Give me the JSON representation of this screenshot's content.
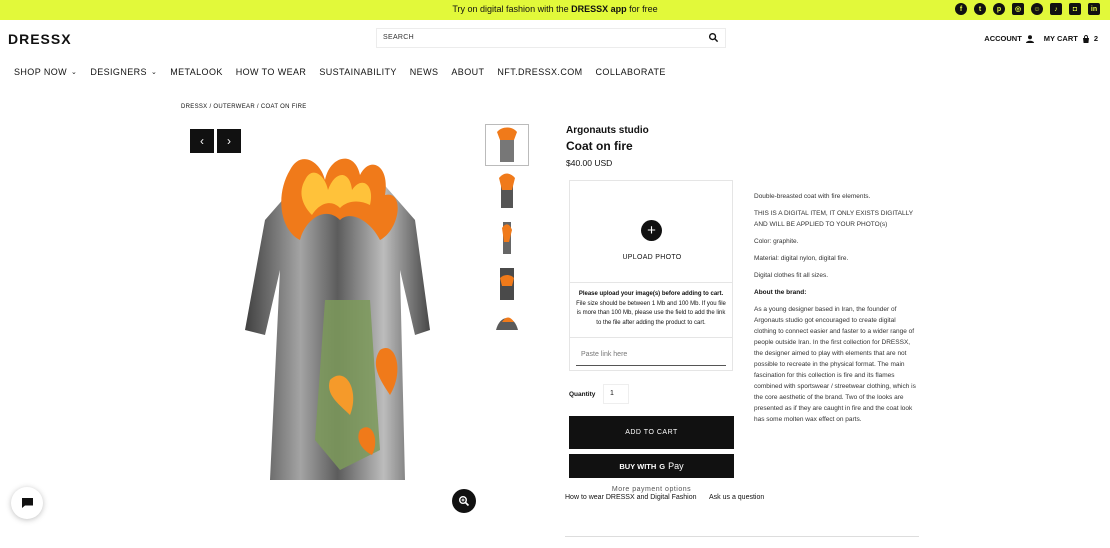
{
  "topbar": {
    "promo_before": "Try on digital fashion with the ",
    "promo_bold": "DRESSX app",
    "promo_after": " for free",
    "bg_color": "#e2f93a",
    "socials": [
      "facebook-icon",
      "twitter-icon",
      "pinterest-icon",
      "instagram-icon",
      "snapchat-icon",
      "tiktok-icon",
      "discord-icon",
      "linkedin-icon"
    ]
  },
  "header": {
    "logo": "DRESSX",
    "search_placeholder": "SEARCH",
    "account_label": "ACCOUNT",
    "cart_label": "MY CART",
    "cart_count": "2"
  },
  "nav": {
    "shop_now": "SHOP NOW",
    "designers": "DESIGNERS",
    "metalook": "METALOOK",
    "how_to_wear": "HOW TO WEAR",
    "sustainability": "SUSTAINABILITY",
    "news": "NEWS",
    "about": "ABOUT",
    "nft": "NFT.DRESSX.COM",
    "collaborate": "COLLABORATE"
  },
  "breadcrumb": {
    "text": "DRESSX / OUTERWEAR / COAT ON FIRE"
  },
  "product": {
    "brand": "Argonauts studio",
    "title": "Coat on fire",
    "price": "$40.00 USD",
    "upload_label": "UPLOAD PHOTO",
    "upload_note_bold": "Please upload your image(s) before adding to cart.",
    "upload_note": "File size should be between 1 Mb and 100 Mb. If you file is more than 100 Mb, please use the field to add the link to the file after adding the product to cart.",
    "link_placeholder": "Paste link here",
    "quantity_label": "Quantity",
    "quantity_value": "1",
    "add_to_cart": "ADD TO CART",
    "buy_with": "BUY WITH",
    "gpay_g": "G",
    "gpay_pay": "Pay",
    "more_payment": "More payment options",
    "link_how_to_wear": "How to wear DRESSX and Digital Fashion",
    "link_ask": "Ask us a question"
  },
  "description": {
    "line1": "Double-breasted coat with fire elements.",
    "line2": "THIS IS A DIGITAL ITEM, IT ONLY EXISTS DIGITALLY AND WILL BE APPLIED TO YOUR PHOTO(s)",
    "line3": "Color: graphite.",
    "line4": "Material: digital nylon, digital fire.",
    "line5": "Digital clothes fit all sizes.",
    "about_heading": "About the brand:",
    "about_text": "As a young designer based in Iran, the founder of Argonauts studio got encouraged to create digital clothing to connect easier and faster to a wider range of people outside Iran. In the first collection for DRESSX, the designer aimed to play with elements that are not possible to recreate in the physical format. The main fascination for this collection is fire and its flames combined with sportswear / streetwear clothing, which is the core aesthetic of the brand. Two of the looks are presented as if they are caught in fire and the coat look has some molten wax effect on parts."
  },
  "colors": {
    "accent": "#e2f93a",
    "button": "#111111"
  }
}
